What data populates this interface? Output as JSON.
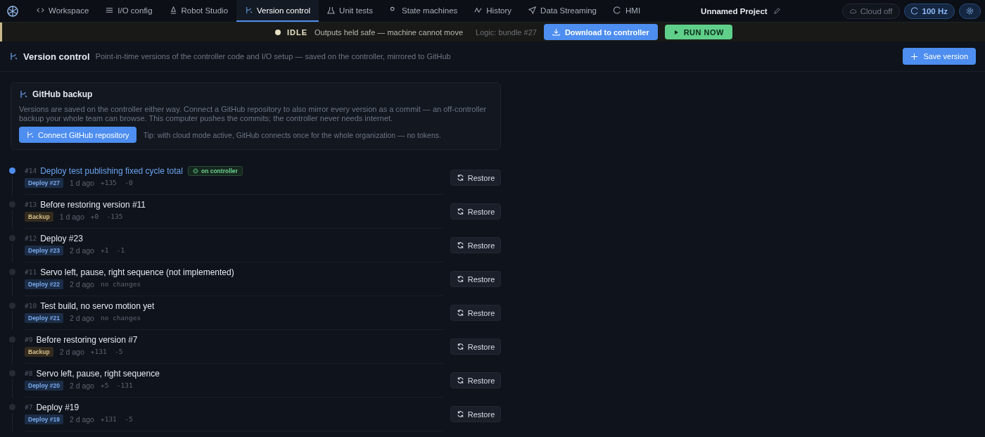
{
  "nav": {
    "tabs": [
      {
        "label": "Workspace",
        "selected": false
      },
      {
        "label": "I/O config",
        "selected": false
      },
      {
        "label": "Robot Studio",
        "selected": false
      },
      {
        "label": "Version control",
        "selected": true
      },
      {
        "label": "Unit tests",
        "selected": false
      },
      {
        "label": "State machines",
        "selected": false
      },
      {
        "label": "History",
        "selected": false
      },
      {
        "label": "Data Streaming",
        "selected": false
      },
      {
        "label": "HMI",
        "selected": false
      }
    ],
    "project": "Unnamed Project",
    "cloud": "Cloud off",
    "rate": "100 Hz"
  },
  "status_bar": {
    "state": "IDLE",
    "message": "Outputs held safe — machine cannot move",
    "logic": "Logic: bundle #27",
    "download": "Download to controller",
    "run": "RUN NOW"
  },
  "header": {
    "title": "Version control",
    "subtitle": "Point-in-time versions of the controller code and I/O setup — saved on the controller, mirrored to GitHub",
    "save": "Save version"
  },
  "github": {
    "title": "GitHub backup",
    "text": "Versions are saved on the controller either way. Connect a GitHub repository to also mirror every version as a commit — an off-controller backup your whole team can browse. This computer pushes the commits; the controller never needs internet.",
    "button": "Connect GitHub repository",
    "tip": "Tip: with cloud mode active, GitHub connects once for the whole organization — no tokens."
  },
  "versions": [
    {
      "number": "#14",
      "title": "Deploy test publishing fixed cycle total",
      "current": true,
      "badge": "on controller",
      "tag": {
        "label": "Deploy #27",
        "kind": "deploy"
      },
      "age": "1 d ago",
      "changes": "+135  -0",
      "restore": "Restore"
    },
    {
      "number": "#13",
      "title": "Before restoring version #11",
      "current": false,
      "tag": {
        "label": "Backup",
        "kind": "backup"
      },
      "age": "1 d ago",
      "changes": "+0  -135",
      "restore": "Restore"
    },
    {
      "number": "#12",
      "title": "Deploy #23",
      "current": false,
      "tag": {
        "label": "Deploy #23",
        "kind": "deploy"
      },
      "age": "2 d ago",
      "changes": "+1  -1",
      "restore": "Restore"
    },
    {
      "number": "#11",
      "title": "Servo left, pause, right sequence (not implemented)",
      "current": false,
      "tag": {
        "label": "Deploy #22",
        "kind": "deploy"
      },
      "age": "2 d ago",
      "changes": "no changes",
      "restore": "Restore"
    },
    {
      "number": "#10",
      "title": "Test build, no servo motion yet",
      "current": false,
      "tag": {
        "label": "Deploy #21",
        "kind": "deploy"
      },
      "age": "2 d ago",
      "changes": "no changes",
      "restore": "Restore"
    },
    {
      "number": "#9",
      "title": "Before restoring version #7",
      "current": false,
      "tag": {
        "label": "Backup",
        "kind": "backup"
      },
      "age": "2 d ago",
      "changes": "+131  -5",
      "restore": "Restore"
    },
    {
      "number": "#8",
      "title": "Servo left, pause, right sequence",
      "current": false,
      "tag": {
        "label": "Deploy #20",
        "kind": "deploy"
      },
      "age": "2 d ago",
      "changes": "+5  -131",
      "restore": "Restore"
    },
    {
      "number": "#7",
      "title": "Deploy #19",
      "current": false,
      "tag": {
        "label": "Deploy #19",
        "kind": "deploy"
      },
      "age": "2 d ago",
      "changes": "+131  -5",
      "restore": "Restore"
    }
  ]
}
